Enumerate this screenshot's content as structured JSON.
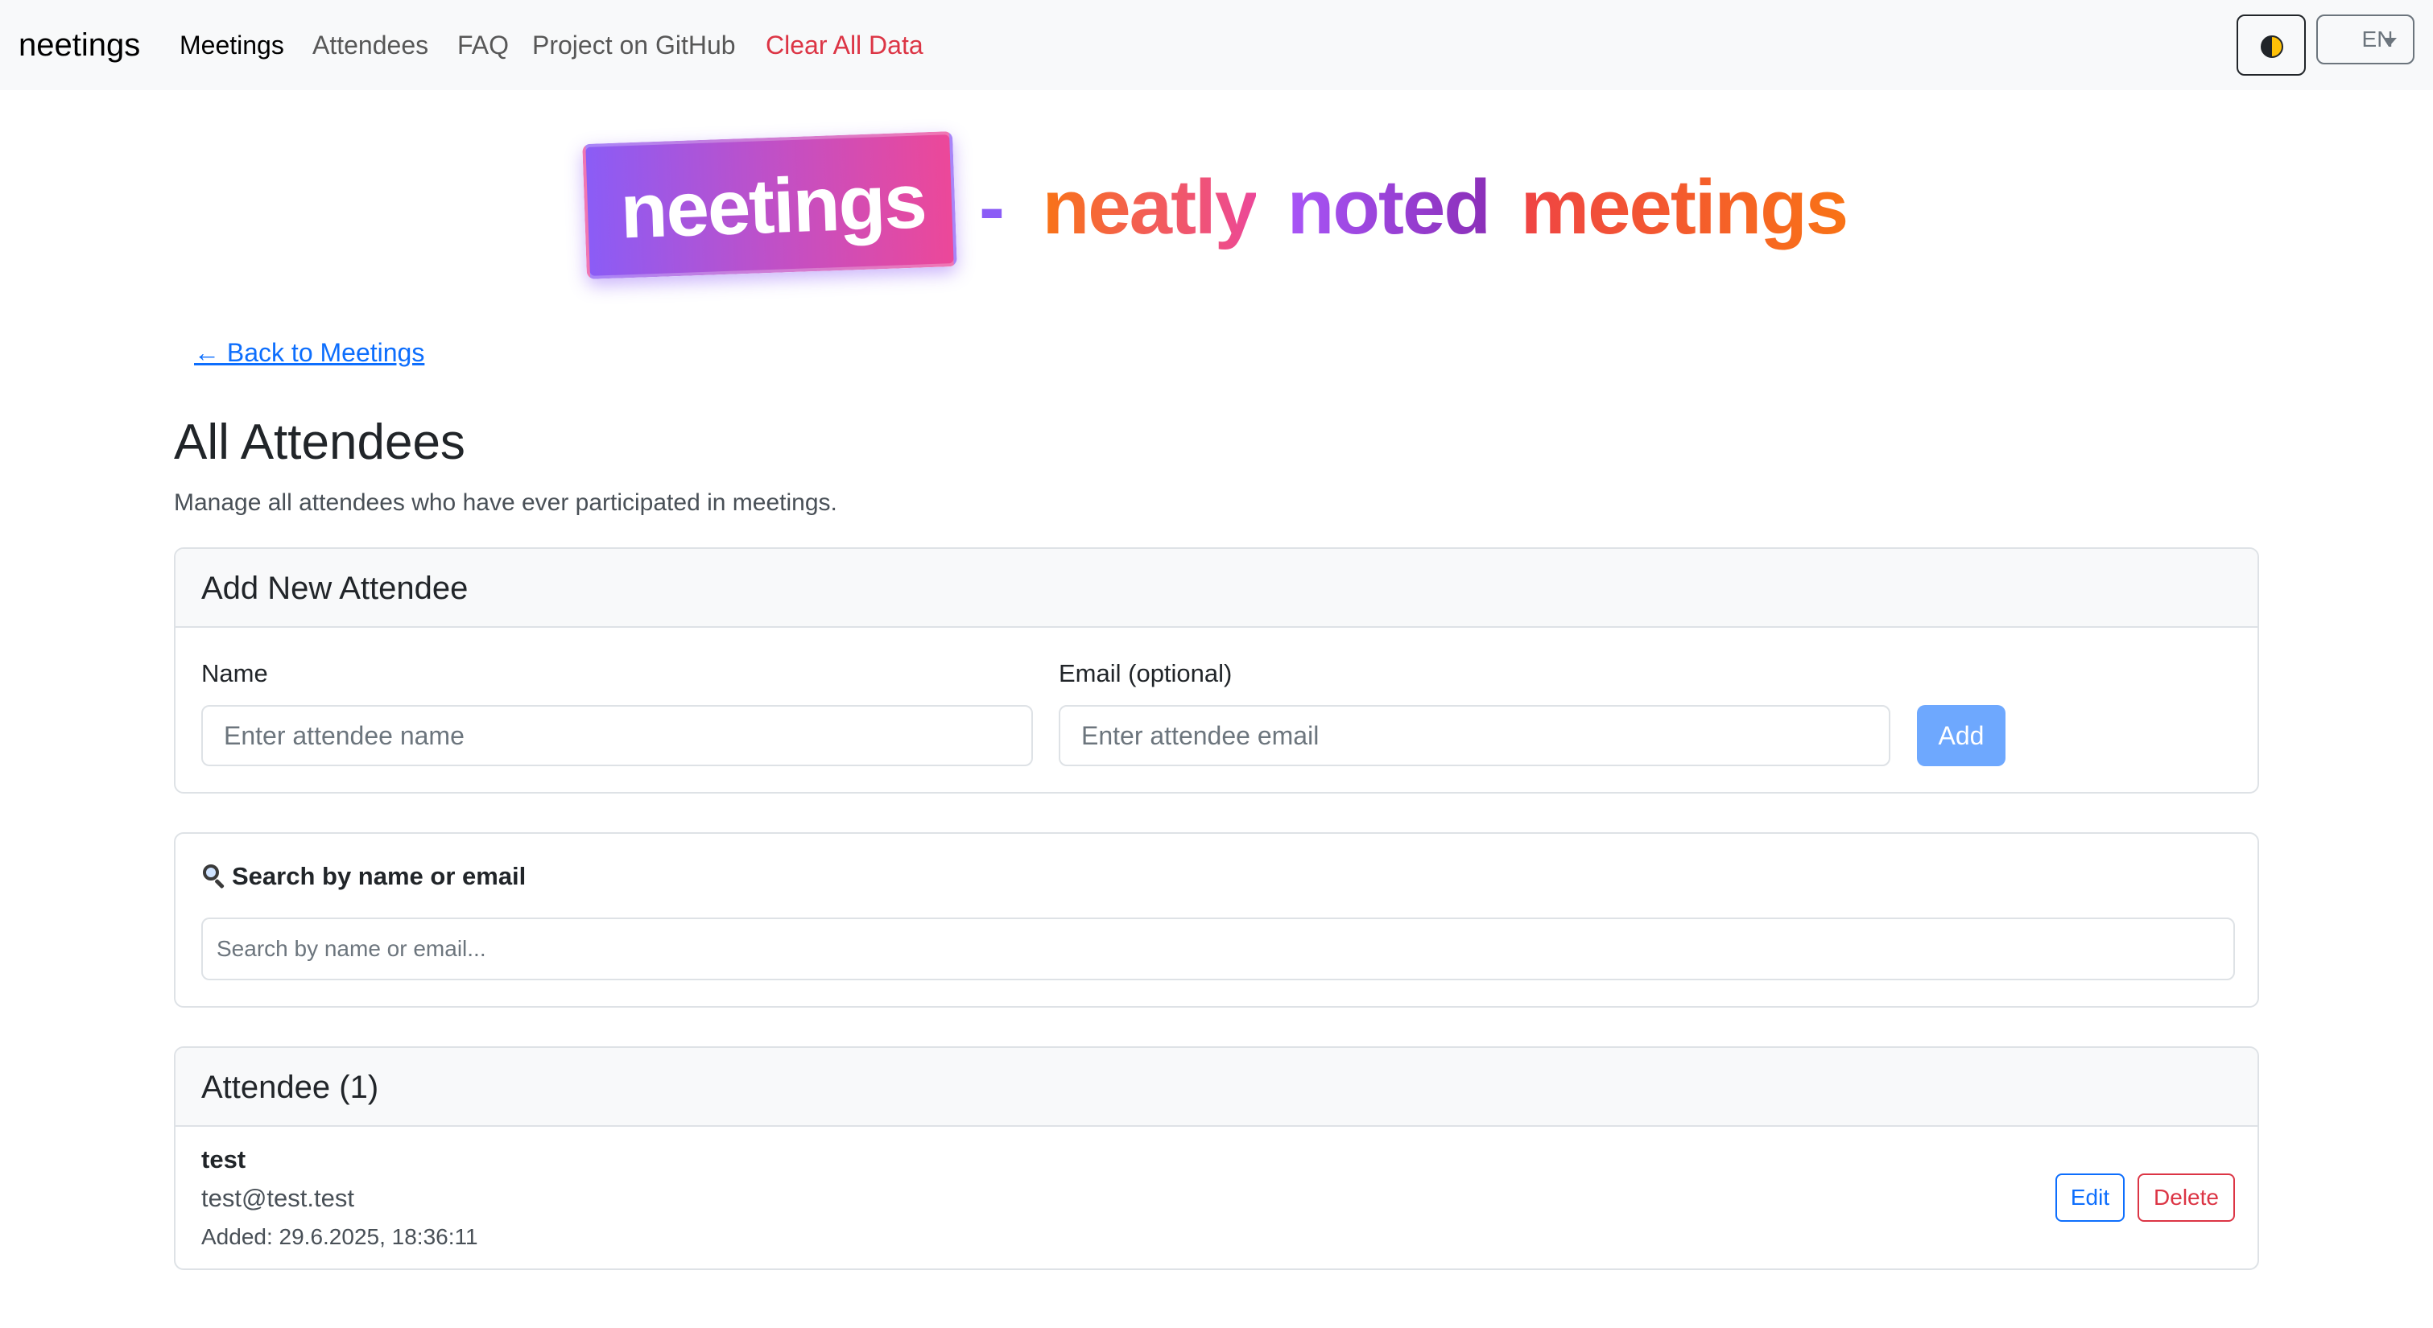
{
  "navbar": {
    "brand": "neetings",
    "links": [
      "Meetings",
      "Attendees",
      "FAQ",
      "Project on GitHub"
    ],
    "clear_all": "Clear All Data",
    "language": "EN"
  },
  "hero": {
    "logo": "neetings",
    "dash": "-",
    "tagline_words": [
      "neatly",
      "noted",
      "meetings"
    ]
  },
  "back_link": "← Back to Meetings",
  "page": {
    "title": "All Attendees",
    "description": "Manage all attendees who have ever participated in meetings."
  },
  "add_card": {
    "header": "Add New Attendee",
    "name_label": "Name",
    "name_placeholder": "Enter attendee name",
    "email_label": "Email (optional)",
    "email_placeholder": "Enter attendee email",
    "add_button": "Add"
  },
  "search_card": {
    "label": "Search by name or email",
    "placeholder": "Search by name or email..."
  },
  "list_card": {
    "header": "Attendee (1)",
    "attendees": [
      {
        "name": "test",
        "email": "test@test.test",
        "added": "Added: 29.6.2025, 18:36:11"
      }
    ],
    "edit_label": "Edit",
    "delete_label": "Delete"
  },
  "colors": {
    "primary": "#0d6efd",
    "danger": "#dc3545",
    "add_button": "#6ea8fe",
    "logo_gradient_start": "#8b5cf6",
    "logo_gradient_end": "#ec4899"
  },
  "icons": {
    "theme_toggle": "half-moon-icon",
    "language_caret": "caret-down-icon",
    "search": "magnifying-glass-icon"
  }
}
